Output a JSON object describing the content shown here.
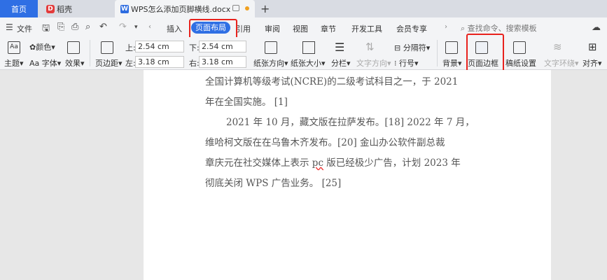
{
  "tabs": {
    "home": "首页",
    "daoke": "稻壳",
    "doc": "WPS怎么添加页脚横线.docx"
  },
  "menu": {
    "file": "文件",
    "insert": "插入",
    "page_layout": "页面布局",
    "references": "引用",
    "review": "审阅",
    "view": "视图",
    "chapter": "章节",
    "dev_tools": "开发工具",
    "member": "会员专享",
    "search_placeholder": "查找命令、搜索模板"
  },
  "ribbon": {
    "theme": "主题",
    "color": "颜色",
    "font": "字体",
    "effect": "效果",
    "margin": "页边距",
    "top_label": "上:",
    "top_value": "2.54 cm",
    "bottom_label": "下:",
    "bottom_value": "2.54 cm",
    "left_label": "左:",
    "left_value": "3.18 cm",
    "right_label": "右:",
    "right_value": "3.18 cm",
    "orientation": "纸张方向",
    "size": "纸张大小",
    "columns": "分栏",
    "text_direction": "文字方向",
    "separator": "分隔符",
    "line_number": "行号",
    "background": "背景",
    "page_border": "页面边框",
    "manuscript": "稿纸设置",
    "wrap": "文字环绕",
    "align": "对齐"
  },
  "document": {
    "line1": "全国计算机等级考试(NCRE)的二级考试科目之一，于 2021",
    "line2": "年在全国实施。 [1]",
    "line3": "2021 年 10 月，藏文版在拉萨发布。[18]  2022 年 7 月，",
    "line4": "维哈柯文版在在乌鲁木齐发布。[20]  金山办公软件副总裁",
    "line5_a": "章庆元在社交媒体上表示 ",
    "line5_b": "pc",
    "line5_c": " 版已经极少广告，计划 2023 年",
    "line6": "彻底关闭 WPS 广告业务。 [25]"
  },
  "colors": {
    "accent": "#2f6fe4",
    "highlight": "#e8221d"
  }
}
